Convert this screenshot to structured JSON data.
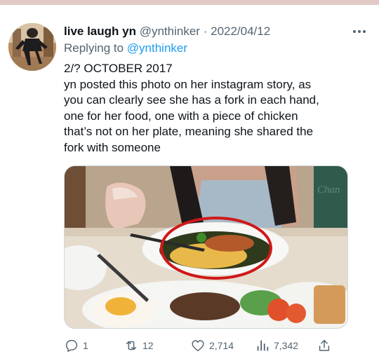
{
  "tweet": {
    "display_name": "live laugh yn",
    "handle": "@ynthinker",
    "separator": "·",
    "date": "2022/04/12",
    "replying_prefix": "Replying to",
    "replying_to": "@ynthinker",
    "body_lines": [
      "2/? OCTOBER 2017",
      "yn posted this photo on her instagram story, as",
      "you can clearly see she has a fork in each hand,",
      "one for her food, one with a piece of chicken",
      "that’s not on her plate, meaning she shared the",
      "fork with someone"
    ],
    "media_watermark": "Chan"
  },
  "actions": {
    "reply_count": "1",
    "retweet_count": "12",
    "like_count": "2,714",
    "view_count": "7,342"
  },
  "icons": {
    "reply": "reply-icon",
    "retweet": "retweet-icon",
    "like": "heart-icon",
    "views": "views-chart-icon",
    "share": "share-icon",
    "more": "more-icon"
  },
  "colors": {
    "text": "#0f1419",
    "secondary": "#536471",
    "link": "#1d9bf0",
    "top_rule": "#e2c9c4",
    "annotation_circle": "#d01818"
  }
}
